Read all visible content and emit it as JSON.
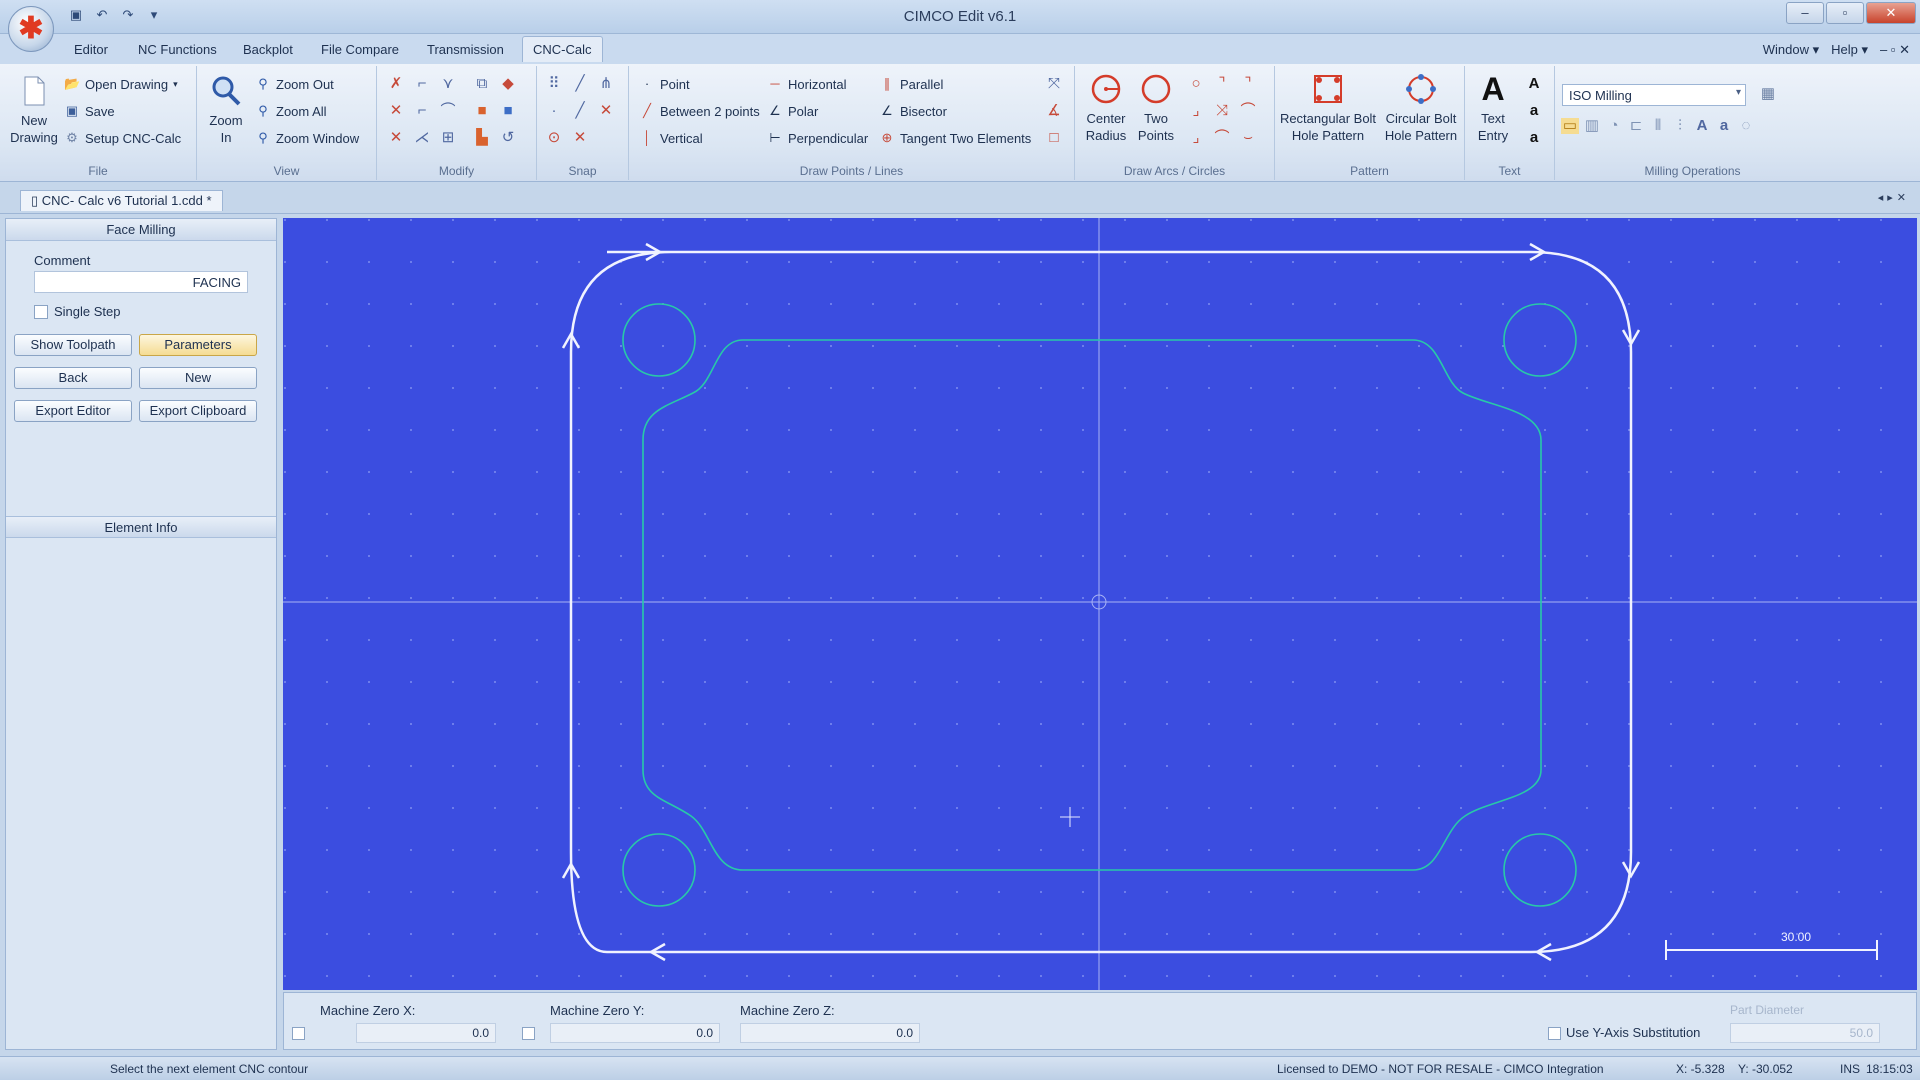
{
  "window": {
    "title": "CIMCO Edit v6.1"
  },
  "menu_tabs": [
    "Editor",
    "NC Functions",
    "Backplot",
    "File Compare",
    "Transmission",
    "CNC-Calc"
  ],
  "menu_right": {
    "window": "Window",
    "help": "Help"
  },
  "ribbon": {
    "file": {
      "label": "File",
      "new_line1": "New",
      "new_line2": "Drawing",
      "open": "Open Drawing",
      "save": "Save",
      "setup": "Setup CNC-Calc"
    },
    "view": {
      "label": "View",
      "zoom_in_line1": "Zoom",
      "zoom_in_line2": "In",
      "zoom_out": "Zoom Out",
      "zoom_all": "Zoom All",
      "zoom_window": "Zoom Window"
    },
    "modify": {
      "label": "Modify"
    },
    "snap": {
      "label": "Snap"
    },
    "draw_points_lines": {
      "label": "Draw Points / Lines",
      "point": "Point",
      "between": "Between 2 points",
      "vertical": "Vertical",
      "horizontal": "Horizontal",
      "polar": "Polar",
      "perpendicular": "Perpendicular",
      "parallel": "Parallel",
      "bisector": "Bisector",
      "tangent": "Tangent Two Elements"
    },
    "draw_arcs": {
      "label": "Draw Arcs / Circles",
      "center_line1": "Center",
      "center_line2": "Radius",
      "two_line1": "Two",
      "two_line2": "Points"
    },
    "pattern": {
      "label": "Pattern",
      "rect_line1": "Rectangular Bolt",
      "rect_line2": "Hole Pattern",
      "circ_line1": "Circular Bolt",
      "circ_line2": "Hole Pattern"
    },
    "text": {
      "label": "Text",
      "entry_line1": "Text",
      "entry_line2": "Entry"
    },
    "milling": {
      "label": "Milling Operations",
      "combo_value": "ISO Milling"
    }
  },
  "document_tab": "CNC- Calc v6 Tutorial 1.cdd *",
  "left_panel": {
    "title": "Face Milling",
    "comment_label": "Comment",
    "comment_value": "FACING",
    "single_step": "Single Step",
    "show_toolpath": "Show Toolpath",
    "parameters": "Parameters",
    "back": "Back",
    "new": "New",
    "export_editor": "Export Editor",
    "export_clipboard": "Export Clipboard",
    "element_info": "Element Info"
  },
  "canvas": {
    "scale_label": "30.00"
  },
  "bottom": {
    "mzx_label": "Machine Zero X:",
    "mzx_value": "0.0",
    "mzy_label": "Machine Zero Y:",
    "mzy_value": "0.0",
    "mzz_label": "Machine Zero Z:",
    "mzz_value": "0.0",
    "y_axis": "Use Y-Axis Substitution",
    "part_diameter_label": "Part Diameter",
    "part_diameter_value": "50.0"
  },
  "status": {
    "message": "Select the next element CNC contour",
    "license": "Licensed to DEMO - NOT FOR RESALE - CIMCO Integration",
    "x": "X: -5.328",
    "y": "Y: -30.052",
    "mode": "INS",
    "time": "18:15:03"
  }
}
